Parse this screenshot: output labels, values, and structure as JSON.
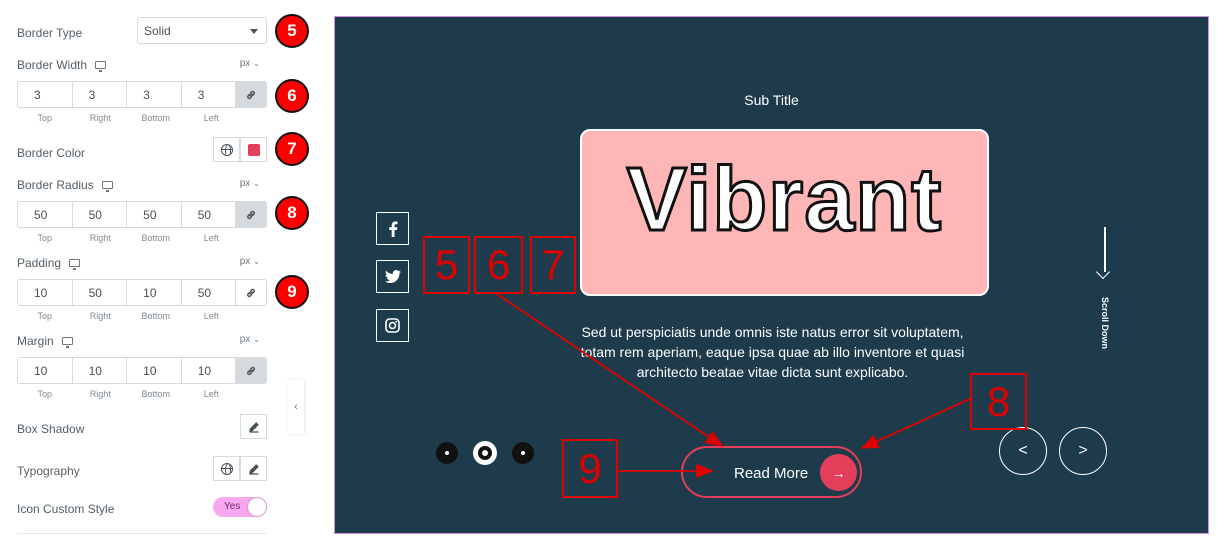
{
  "panel": {
    "border_type": {
      "label": "Border Type",
      "value": "Solid"
    },
    "border_width": {
      "label": "Border Width",
      "unit": "px",
      "values": [
        "3",
        "3",
        "3",
        "3"
      ]
    },
    "border_color": {
      "label": "Border Color",
      "color": "#e43f5a"
    },
    "border_radius": {
      "label": "Border Radius",
      "unit": "px",
      "values": [
        "50",
        "50",
        "50",
        "50"
      ]
    },
    "padding": {
      "label": "Padding",
      "unit": "px",
      "values": [
        "10",
        "50",
        "10",
        "50"
      ]
    },
    "margin": {
      "label": "Margin",
      "unit": "px",
      "values": [
        "10",
        "10",
        "10",
        "10"
      ]
    },
    "dim_labels": [
      "Top",
      "Right",
      "Bottom",
      "Left"
    ],
    "box_shadow": {
      "label": "Box Shadow"
    },
    "typography": {
      "label": "Typography"
    },
    "icon_custom_style": {
      "label": "Icon Custom Style",
      "value": "Yes"
    }
  },
  "badges": [
    "5",
    "6",
    "7",
    "8",
    "9"
  ],
  "preview": {
    "subtitle": "Sub Title",
    "title": "Vibrant",
    "description": "Sed ut perspiciatis unde omnis iste natus error sit voluptatem, totam rem aperiam, eaque ipsa quae ab illo inventore et quasi architecto beatae vitae dicta sunt explicabo.",
    "button_label": "Read More",
    "scroll_label": "Scroll Down",
    "social": [
      "f",
      "t",
      "ig"
    ],
    "pagination_active_index": 1
  },
  "markers": [
    "5",
    "6",
    "7",
    "8",
    "9"
  ],
  "colors": {
    "accent": "#e43f5a",
    "preview_bg": "#1e3b4b",
    "title_box": "#ffb6b6",
    "annotation": "#e00000"
  }
}
